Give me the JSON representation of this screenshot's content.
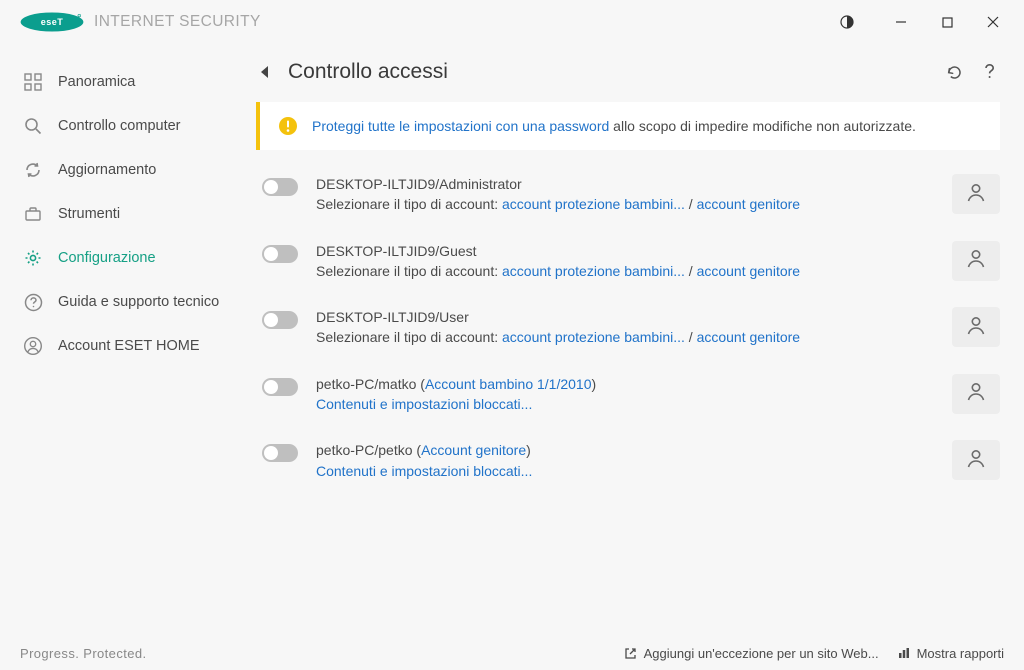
{
  "brand": {
    "name": "INTERNET SECURITY"
  },
  "sidebar": {
    "items": [
      {
        "label": "Panoramica"
      },
      {
        "label": "Controllo computer"
      },
      {
        "label": "Aggiornamento"
      },
      {
        "label": "Strumenti"
      },
      {
        "label": "Configurazione"
      },
      {
        "label": "Guida e supporto tecnico"
      },
      {
        "label": "Account ESET HOME"
      }
    ]
  },
  "page": {
    "title": "Controllo accessi"
  },
  "notice": {
    "link": "Proteggi tutte le impostazioni con una password",
    "rest": " allo scopo di impedire modifiche non autorizzate."
  },
  "labels": {
    "select_prompt": "Selezionare il tipo di account: ",
    "child_link": "account protezione bambini...",
    "parent_link": "account genitore",
    "blocked_link": "Contenuti e impostazioni bloccati...",
    "sep": " / "
  },
  "accounts": [
    {
      "title": "DESKTOP-ILTJID9/Administrator",
      "mode": "prompt"
    },
    {
      "title": "DESKTOP-ILTJID9/Guest",
      "mode": "prompt"
    },
    {
      "title": "DESKTOP-ILTJID9/User",
      "mode": "prompt"
    },
    {
      "title_prefix": "petko-PC/matko (",
      "title_link": "Account bambino 1/1/2010",
      "title_suffix": ")",
      "mode": "blocked"
    },
    {
      "title_prefix": "petko-PC/petko (",
      "title_link": "Account genitore",
      "title_suffix": ")",
      "mode": "blocked"
    }
  ],
  "footer": {
    "tagline": "Progress. Protected.",
    "exception": "Aggiungi un'eccezione per un sito Web...",
    "reports": "Mostra rapporti"
  }
}
